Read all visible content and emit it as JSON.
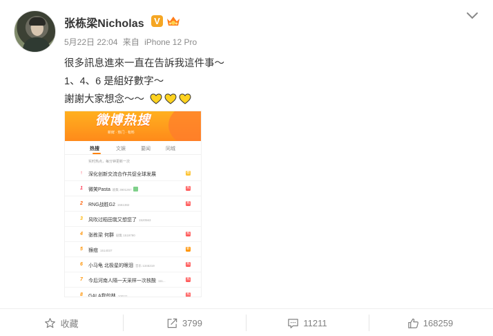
{
  "author": {
    "name": "张栋梁Nicholas",
    "verified_badge": "V",
    "avatar_icon": "user-avatar"
  },
  "post": {
    "date": "5月22日 22:04",
    "source_prefix": "来自",
    "source": "iPhone 12 Pro",
    "lines": [
      "很多訊息進來一直在告訴我這件事～",
      "1、4、6 是組好數字～",
      "謝謝大家想念～～"
    ],
    "heart_count": 3,
    "heart_color": "#ffd21f"
  },
  "embedded_screenshot": {
    "banner_title": "微博热搜",
    "banner_sub": "新鲜 · 热门 · 有料",
    "tabs": [
      "热搜",
      "文娱",
      "要闻",
      "同城"
    ],
    "active_tab": "热搜",
    "hint": "实时热点，每分钟更新一次",
    "rows": [
      {
        "rank": "↑",
        "title": "深化创新交流合作共促全球发展",
        "heat": "",
        "tag": "荐",
        "tag_type": "jian",
        "rank_color": "#ff3852"
      },
      {
        "rank": "1",
        "title": "微笑Pasta",
        "heat": "剧集 3901267",
        "tag": "热",
        "tag_type": "re",
        "rank_color": "#ff3852",
        "emoji": true
      },
      {
        "rank": "2",
        "title": "RNG战胜G2",
        "heat": "1551382",
        "tag": "热",
        "tag_type": "re",
        "rank_color": "#ff5d00"
      },
      {
        "rank": "3",
        "title": "风吹过稻田我又想您了",
        "heat": "1520563",
        "tag": "",
        "tag_type": "",
        "rank_color": "#ffb400"
      },
      {
        "rank": "4",
        "title": "张栋梁 何群",
        "heat": "剧集 1519790",
        "tag": "热",
        "tag_type": "re",
        "rank_color": "#ff9406"
      },
      {
        "rank": "5",
        "title": "猴痘",
        "heat": "1514037",
        "tag": "新",
        "tag_type": "xin",
        "rank_color": "#ff9406"
      },
      {
        "rank": "6",
        "title": "小马龟 北极星的眼泪",
        "heat": "音乐 1346219",
        "tag": "热",
        "tag_type": "re",
        "rank_color": "#ff9406"
      },
      {
        "rank": "7",
        "title": "今后河南人隔一天采样一次核酸",
        "heat": "111...",
        "tag": "热",
        "tag_type": "re",
        "rank_color": "#ff9406"
      },
      {
        "rank": "8",
        "title": "GALA我的林",
        "heat": "100111",
        "tag": "热",
        "tag_type": "re",
        "rank_color": "#ff9406"
      }
    ]
  },
  "actions": [
    {
      "icon": "star-icon",
      "label": "收藏"
    },
    {
      "icon": "share-icon",
      "label": "3799"
    },
    {
      "icon": "comment-icon",
      "label": "11211"
    },
    {
      "icon": "like-icon",
      "label": "168259"
    }
  ]
}
